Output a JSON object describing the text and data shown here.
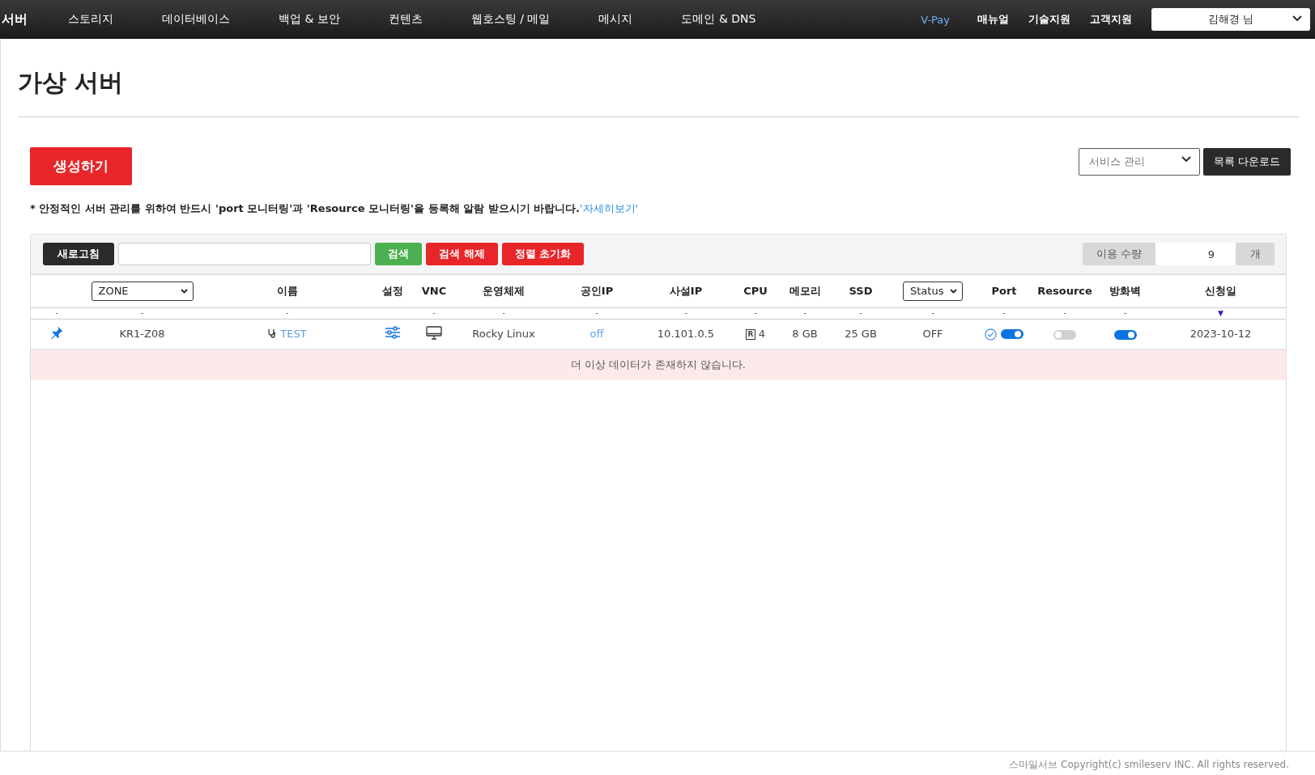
{
  "nav": {
    "items": [
      {
        "label": "서버",
        "selected": true
      },
      {
        "label": "스토리지",
        "selected": false
      },
      {
        "label": "데이터베이스",
        "selected": false
      },
      {
        "label": "백업 & 보안",
        "selected": false
      },
      {
        "label": "컨텐츠",
        "selected": false
      },
      {
        "label": "웹호스팅 / 메일",
        "selected": false
      },
      {
        "label": "메시지",
        "selected": false
      },
      {
        "label": "도메인 & DNS",
        "selected": false
      }
    ],
    "links": [
      {
        "label": "V-Pay",
        "kind": "highlight"
      },
      {
        "label": "매뉴얼",
        "kind": "plain"
      },
      {
        "label": "기술지원",
        "kind": "plain"
      },
      {
        "label": "고객지원",
        "kind": "plain"
      }
    ],
    "user": "김해경 님"
  },
  "title": "가상 서버",
  "create_button": "생성하기",
  "service_select": "서비스 관리",
  "download_button": "목록 다운로드",
  "notice": "* 안정적인 서버 관리를 위하여 반드시 'port 모니터링'과 'Resource 모니터링'을 등록해 알람 받으시기 바랍니다.",
  "notice_link": "'자세히보기'",
  "toolbar": {
    "refresh": "새로고침",
    "search": "검색",
    "clear_search": "검색 해제",
    "reset_sort": "정렬 초기화",
    "usage_label": "이용 수량",
    "usage_value": "9",
    "usage_unit": "개"
  },
  "columns": [
    {
      "kind": "blank",
      "sort": "-"
    },
    {
      "kind": "select",
      "label": "ZONE",
      "sort": "-"
    },
    {
      "kind": "text",
      "label": "이름",
      "sort": "-"
    },
    {
      "kind": "text",
      "label": "설정"
    },
    {
      "kind": "text",
      "label": "VNC",
      "sort": "-"
    },
    {
      "kind": "text",
      "label": "운영체제",
      "sort": "-"
    },
    {
      "kind": "text",
      "label": "공인IP",
      "sort": "-"
    },
    {
      "kind": "text",
      "label": "사설IP",
      "sort": "-"
    },
    {
      "kind": "text",
      "label": "CPU",
      "sort": "-"
    },
    {
      "kind": "text",
      "label": "메모리",
      "sort": "-"
    },
    {
      "kind": "text",
      "label": "SSD",
      "sort": "-"
    },
    {
      "kind": "select",
      "label": "Status",
      "sort": "-"
    },
    {
      "kind": "text",
      "label": "Port",
      "sort": "-"
    },
    {
      "kind": "text",
      "label": "Resource",
      "sort": "-"
    },
    {
      "kind": "text",
      "label": "방화벽",
      "sort": "-"
    },
    {
      "kind": "text",
      "label": "신청일",
      "sort": "▼"
    }
  ],
  "rows": [
    {
      "pinned": true,
      "zone": "KR1-Z08",
      "name": "TEST",
      "os": "Rocky Linux",
      "public_ip": "off",
      "private_ip": "10.101.0.5",
      "cpu_badge": "R",
      "cpu": "4",
      "memory": "8 GB",
      "ssd": "25 GB",
      "status": "OFF",
      "port_checked": true,
      "port_on": true,
      "resource_on": false,
      "firewall_on": true,
      "date": "2023-10-12"
    }
  ],
  "empty_message": "더 이상 데이터가 존재하지 않습니다.",
  "footer": "스마일서브 Copyright(c) smileserv INC. All rights reserved."
}
